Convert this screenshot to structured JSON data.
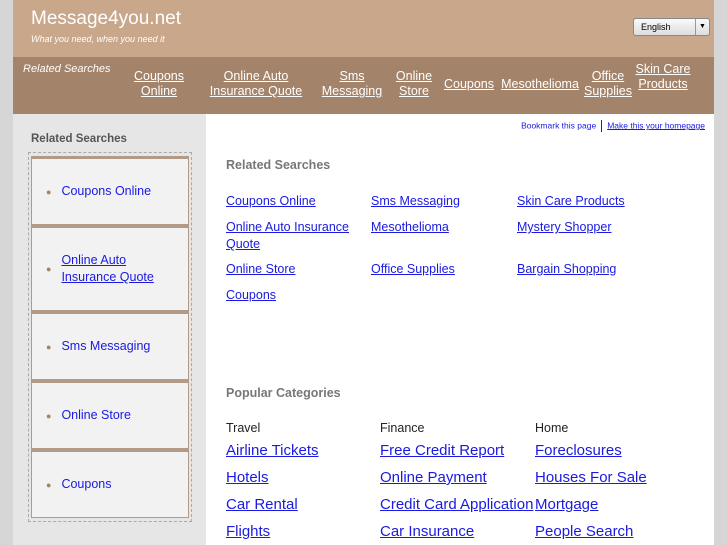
{
  "header": {
    "title": "Message4you.net",
    "tagline": "What you need, when you need it",
    "language": "English"
  },
  "nav": {
    "label": "Related Searches",
    "items": [
      "Coupons Online",
      "Online Auto Insurance Quote",
      "Sms Messaging",
      "Online Store",
      "Coupons",
      "Mesothelioma",
      "Office Supplies",
      "Skin Care Products"
    ]
  },
  "sidebar": {
    "title": "Related Searches",
    "items": [
      "Coupons Online",
      "Online Auto Insurance Quote",
      "Sms Messaging",
      "Online Store",
      "Coupons"
    ]
  },
  "top_links": {
    "bookmark": "Bookmark this page",
    "homepage": "Make this your homepage"
  },
  "related": {
    "title": "Related Searches",
    "items": [
      "Coupons Online",
      "Sms Messaging",
      "Skin Care Products",
      "Online Auto Insurance Quote",
      "Mesothelioma",
      "Mystery Shopper",
      "Online Store",
      "Office Supplies",
      "Bargain Shopping",
      "Coupons"
    ]
  },
  "popular": {
    "title": "Popular Categories",
    "columns": [
      {
        "heading": "Travel",
        "items": [
          "Airline Tickets",
          "Hotels",
          "Car Rental",
          "Flights"
        ]
      },
      {
        "heading": "Finance",
        "items": [
          "Free Credit Report",
          "Online Payment",
          "Credit Card Application",
          "Car Insurance"
        ]
      },
      {
        "heading": "Home",
        "items": [
          "Foreclosures",
          "Houses For Sale",
          "Mortgage",
          "People Search"
        ]
      }
    ]
  }
}
